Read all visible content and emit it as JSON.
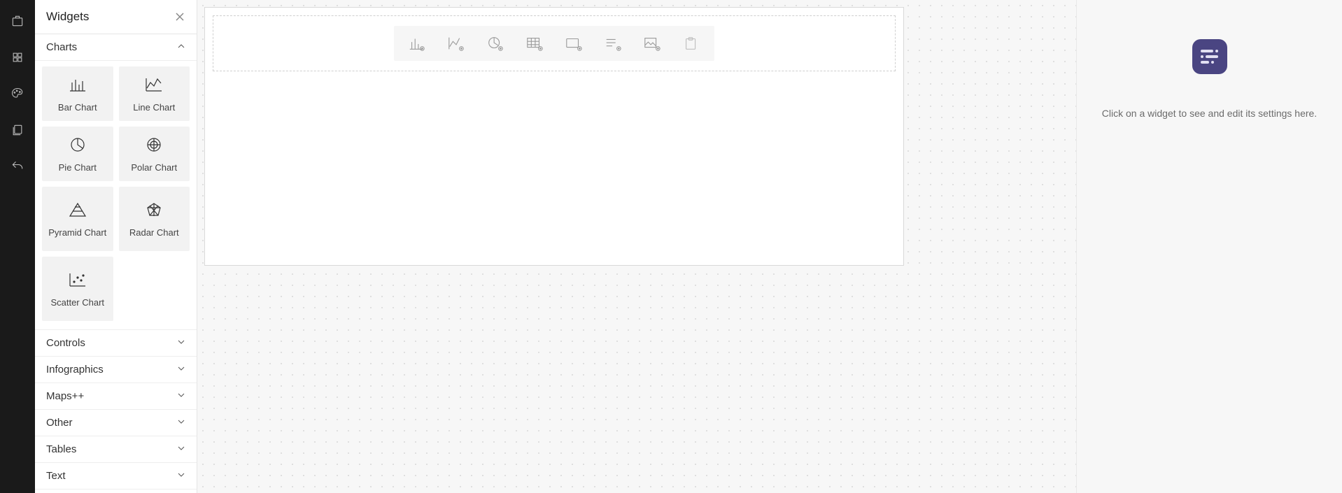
{
  "panel_title": "Widgets",
  "sections": {
    "charts": {
      "label": "Charts",
      "items": {
        "bar": "Bar Chart",
        "line": "Line Chart",
        "pie": "Pie Chart",
        "polar": "Polar Chart",
        "pyramid": "Pyramid Chart",
        "radar": "Radar Chart",
        "scatter": "Scatter Chart"
      }
    },
    "controls": {
      "label": "Controls"
    },
    "infographics": {
      "label": "Infographics"
    },
    "maps": {
      "label": "Maps++"
    },
    "other": {
      "label": "Other"
    },
    "tables": {
      "label": "Tables"
    },
    "text": {
      "label": "Text"
    }
  },
  "settings_hint": "Click on a widget to see and edit its settings here."
}
